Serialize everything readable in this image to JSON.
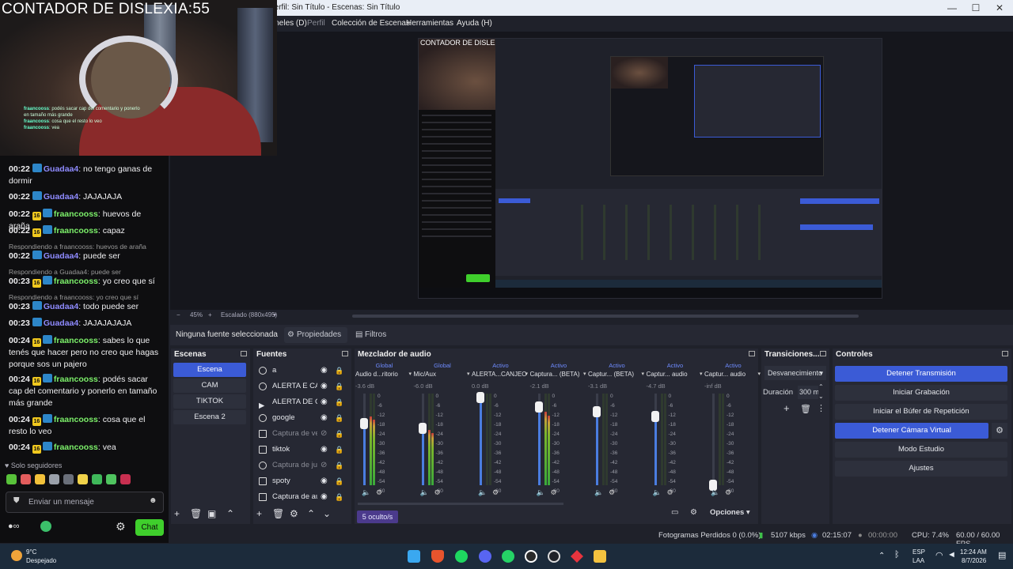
{
  "window": {
    "title": "Perfil: Sin Título - Escenas: Sin Título",
    "minimize": "—",
    "maximize": "☐",
    "close": "✕"
  },
  "menu": [
    "Paneles (D)",
    "Perfil",
    "Colección de Escenas",
    "Herramientas",
    "Ayuda (H)"
  ],
  "preview": {
    "zoom": "45%",
    "scale_label": "Escalado (880x495)"
  },
  "webcam": {
    "counter": "CONTADOR DE DISLEXIA:55",
    "chat1_user": "fraancooss",
    "chat1_text": ": podés sacar cap del comentario y ponerlo en tamaño más grande",
    "chat2_user": "fraancooss",
    "chat2_text": ": cosa que el resto lo veo",
    "chat3_user": "fraancooss",
    "chat3_text": ": vea"
  },
  "chat": {
    "messages": [
      {
        "time": "00:22",
        "user": "Guadaa4",
        "text": ": no tengo ganas de dormir",
        "badge": ""
      },
      {
        "time": "00:22",
        "user": "Guadaa4",
        "text": ": JAJAJAJA",
        "badge": ""
      },
      {
        "time": "00:22",
        "user": "fraancooss",
        "text": ": huevos de araña",
        "badge": "16"
      },
      {
        "time": "00:22",
        "user": "fraancooss",
        "text": ": capaz",
        "badge": "16"
      },
      {
        "time": "00:22",
        "user": "Guadaa4",
        "text": ": puede ser",
        "badge": ""
      },
      {
        "time": "00:23",
        "user": "fraancooss",
        "text": ": yo creo que sí",
        "badge": "16"
      },
      {
        "time": "00:23",
        "user": "Guadaa4",
        "text": ": todo puede ser",
        "badge": ""
      },
      {
        "time": "00:23",
        "user": "Guadaa4",
        "text": ": JAJAJAJAJA",
        "badge": ""
      },
      {
        "time": "00:24",
        "user": "fraancooss",
        "text": ": sabes lo que tenés que hacer pero no creo que hagas porque sos un pajero",
        "badge": "16"
      },
      {
        "time": "00:24",
        "user": "fraancooss",
        "text": ": podés sacar cap del comentario y ponerlo en tamaño más grande",
        "badge": "16"
      },
      {
        "time": "00:24",
        "user": "fraancooss",
        "text": ": cosa que el resto lo veo",
        "badge": "16"
      },
      {
        "time": "00:24",
        "user": "fraancooss",
        "text": ": vea",
        "badge": "16"
      }
    ],
    "replies": [
      "Respondiendo a fraancooss: huevos de araña",
      "Respondiendo a Guadaa4: puede ser",
      "Respondiendo a fraancooss: yo creo que sí"
    ],
    "followers_only": "Solo seguidores",
    "input_placeholder": "Enviar un mensaje",
    "chat_button": "Chat"
  },
  "source_bar": {
    "no_selection": "Ninguna fuente seleccionada",
    "properties": "Propiedades",
    "filters": "Filtros"
  },
  "scenes": {
    "title": "Escenas",
    "items": [
      "Escena",
      "CAM",
      "TIKTOK",
      "Escena 2"
    ]
  },
  "sources": {
    "title": "Fuentes",
    "items": [
      "a",
      "ALERTA E CANJEO",
      "ALERTA DE CANJEO",
      "google",
      "Captura de ventana",
      "tiktok",
      "Captura de juego",
      "spoty",
      "Captura de audio"
    ]
  },
  "mixer": {
    "title": "Mezclador de audio",
    "channels": [
      {
        "hdr": "Global",
        "name": "Audio d...ritorio",
        "db": "-3.6 dB",
        "level": 0.75,
        "fader": 0.67
      },
      {
        "hdr": "Global",
        "name": "Mic/Aux",
        "db": "-6.0 dB",
        "level": 0.6,
        "fader": 0.62
      },
      {
        "hdr": "Activo",
        "name": "ALERTA...CANJEO",
        "db": "0.0 dB",
        "level": 0.0,
        "fader": 0.96
      },
      {
        "hdr": "Activo",
        "name": "Captura... (BETA)",
        "db": "-2.1 dB",
        "level": 0.8,
        "fader": 0.85
      },
      {
        "hdr": "Activo",
        "name": "Captur... (BETA)",
        "db": "-3.1 dB",
        "level": 0.0,
        "fader": 0.8
      },
      {
        "hdr": "Activo",
        "name": "Captur... audio",
        "db": "-4.7 dB",
        "level": 0.0,
        "fader": 0.75
      },
      {
        "hdr": "Activo",
        "name": "Captur... audio",
        "db": "-inf dB",
        "level": 0.0,
        "fader": 0.0
      },
      {
        "hdr": "Activo",
        "name": "Captur...",
        "db": "-22.1 dB",
        "level": 0.0,
        "fader": 0.4
      }
    ],
    "scale": [
      "0",
      "-6",
      "-12",
      "-18",
      "-24",
      "-30",
      "-36",
      "-42",
      "-48",
      "-54",
      "-60"
    ],
    "hidden": "5 oculto/s",
    "options": "Opciones"
  },
  "transitions": {
    "title": "Transiciones...",
    "type": "Desvanecimiento",
    "duration_label": "Duración",
    "duration_value": "300 ms"
  },
  "controls": {
    "title": "Controles",
    "buttons": [
      "Detener Transmisión",
      "Iniciar Grabación",
      "Iniciar el Búfer de Repetición",
      "Detener Cámara Virtual",
      "Modo Estudio",
      "Ajustes"
    ]
  },
  "status": {
    "dropped": "Fotogramas Perdidos 0 (0.0%)",
    "bitrate": "5107 kbps",
    "stream_time": "02:15:07",
    "rec_time": "00:00:00",
    "cpu": "CPU: 7.4%",
    "fps": "60.00 / 60.00 FPS"
  },
  "taskbar": {
    "temp": "9°C",
    "weather": "Despejado",
    "lang1": "ESP",
    "lang2": "LAA",
    "time": "12:24 AM",
    "date": "8/7/2026"
  }
}
